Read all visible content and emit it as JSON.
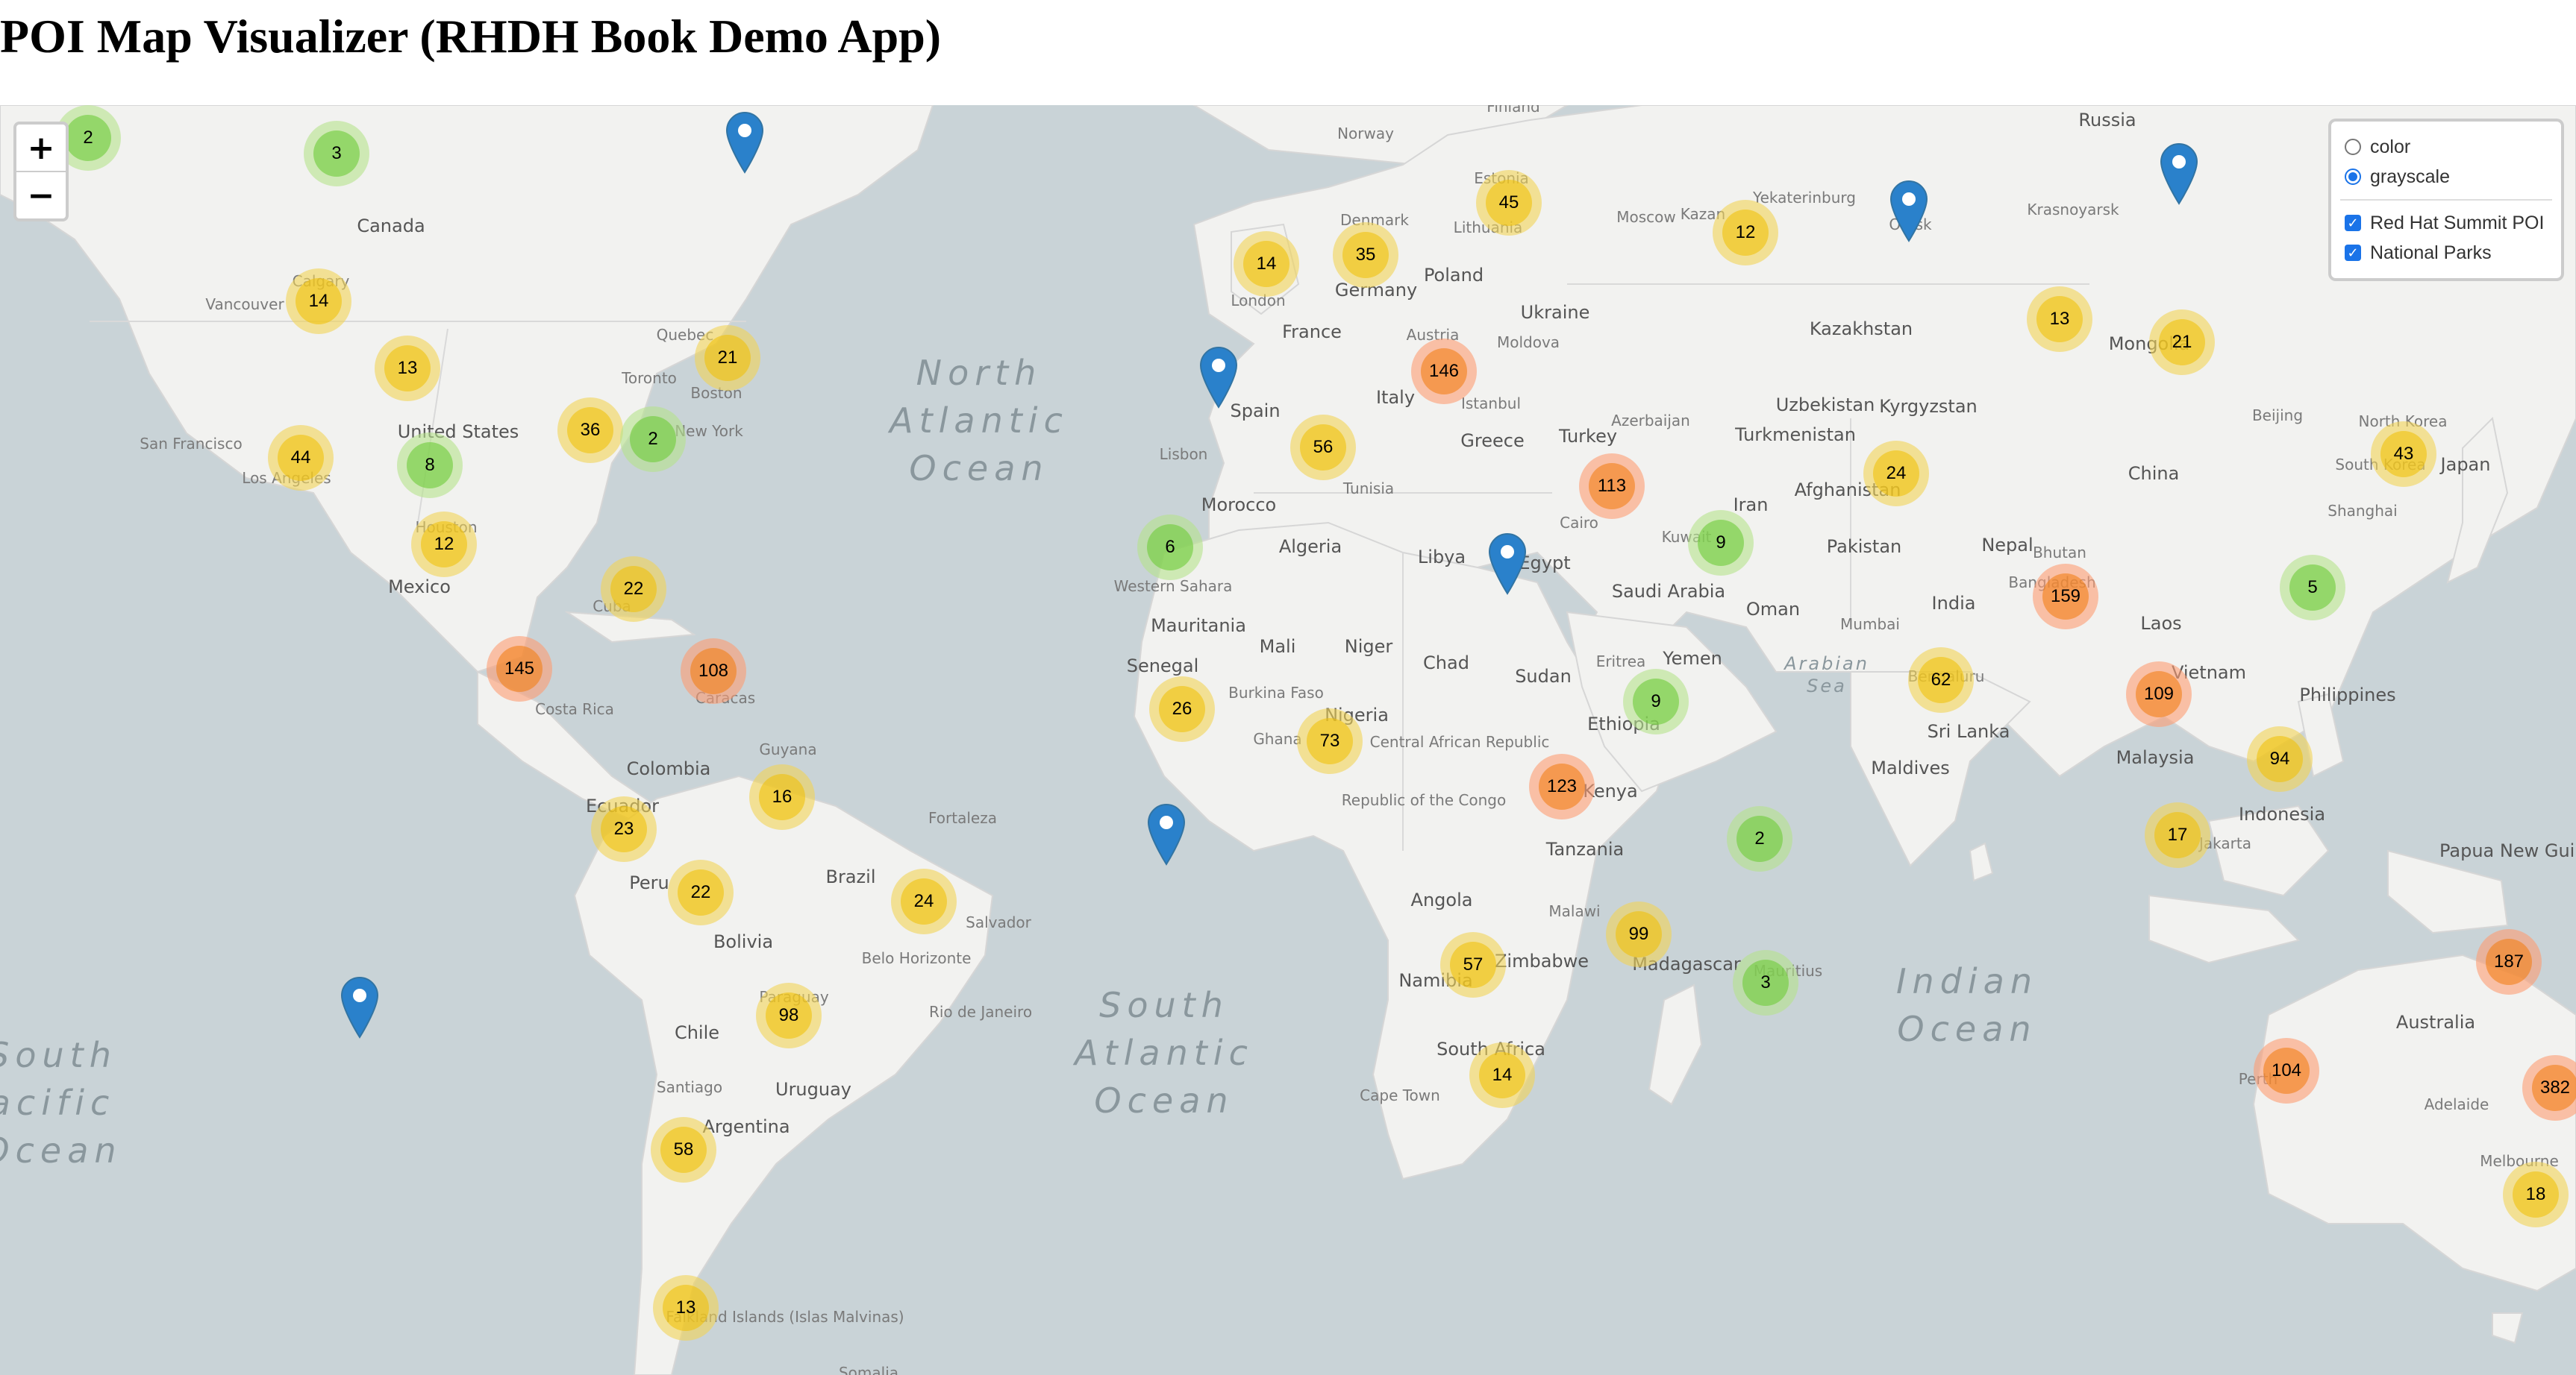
{
  "page": {
    "title": "POI Map Visualizer (RHDH Book Demo App)"
  },
  "map_controls": {
    "zoom_in_label": "+",
    "zoom_out_label": "−"
  },
  "layer_control": {
    "base_layers": [
      {
        "label": "color",
        "selected": false
      },
      {
        "label": "grayscale",
        "selected": true
      }
    ],
    "overlays": [
      {
        "label": "Red Hat Summit POI",
        "checked": true
      },
      {
        "label": "National Parks",
        "checked": true
      }
    ]
  },
  "cluster_colors": {
    "small": "#6ecc39",
    "medium": "#f0c20c",
    "large": "#f18017"
  },
  "marker_color": "#2a81cb",
  "labels": {
    "oceans": [
      "North\nAtlantic\nOcean",
      "South\nAtlantic\nOcean",
      "Indian\nOcean",
      "South\nacific\nOcean"
    ],
    "seas": [
      "Arabian\nSea"
    ],
    "countries": [
      "Canada",
      "United States",
      "Mexico",
      "Colombia",
      "Ecuador",
      "Peru",
      "Brazil",
      "Bolivia",
      "Chile",
      "Argentina",
      "Uruguay",
      "Guyana",
      "Paraguay",
      "Costa Rica",
      "Cuba",
      "Russia",
      "Kazakhstan",
      "Ukraine",
      "Poland",
      "Germany",
      "France",
      "Spain",
      "Italy",
      "Greece",
      "Turkey",
      "Iran",
      "Saudi Arabia",
      "Egypt",
      "Libya",
      "Algeria",
      "Morocco",
      "Tunisia",
      "Mali",
      "Niger",
      "Chad",
      "Sudan",
      "Mauritania",
      "Senegal",
      "Burkina Faso",
      "Ghana",
      "Nigeria",
      "Central African Republic",
      "Republic of the Congo",
      "Angola",
      "Namibia",
      "Zimbabwe",
      "South Africa",
      "Tanzania",
      "Kenya",
      "Ethiopia",
      "Eritrea",
      "Yemen",
      "Oman",
      "Pakistan",
      "Afghanistan",
      "Uzbekistan",
      "Kyrgyzstan",
      "Turkmenistan",
      "India",
      "Nepal",
      "Bhutan",
      "Bangladesh",
      "China",
      "Mongolia",
      "Japan",
      "North Korea",
      "South Korea",
      "Laos",
      "Vietnam",
      "Malaysia",
      "Indonesia",
      "Philippines",
      "Papua New Guinea",
      "Australia",
      "Sri Lanka",
      "Maldives",
      "Madagascar",
      "Malawi",
      "Norway",
      "Finland",
      "Denmark",
      "Estonia",
      "Lithuania",
      "Austria",
      "Moldova",
      "Azerbaijan",
      "Kuwait",
      "Western Sahara",
      "Falkland Islands (Islas Malvinas)",
      "Somalia"
    ],
    "cities": [
      "Vancouver",
      "San Francisco",
      "Los Angeles",
      "Houston",
      "Toronto",
      "Quebec",
      "Boston",
      "New York",
      "Caracas",
      "Fortaleza",
      "Salvador",
      "Belo Horizonte",
      "Rio de Janeiro",
      "Santiago",
      "Moscow",
      "Kazan",
      "Yekaterinburg",
      "Omsk",
      "Krasnoyarsk",
      "London",
      "Lisbon",
      "Istanbul",
      "Cairo",
      "Beijing",
      "Shanghai",
      "Mumbai",
      "Bengaluru",
      "Jakarta",
      "Perth",
      "Adelaide",
      "Melbourne",
      "Cape Town",
      "Calgary",
      "Mauritius"
    ]
  },
  "clusters": [
    {
      "count": "2",
      "size": "small"
    },
    {
      "count": "3",
      "size": "small"
    },
    {
      "count": "14",
      "size": "medium"
    },
    {
      "count": "13",
      "size": "medium"
    },
    {
      "count": "44",
      "size": "medium"
    },
    {
      "count": "8",
      "size": "small"
    },
    {
      "count": "36",
      "size": "medium"
    },
    {
      "count": "2",
      "size": "small"
    },
    {
      "count": "21",
      "size": "medium"
    },
    {
      "count": "12",
      "size": "medium"
    },
    {
      "count": "22",
      "size": "medium"
    },
    {
      "count": "145",
      "size": "large"
    },
    {
      "count": "108",
      "size": "large"
    },
    {
      "count": "16",
      "size": "medium"
    },
    {
      "count": "23",
      "size": "medium"
    },
    {
      "count": "22",
      "size": "medium"
    },
    {
      "count": "24",
      "size": "medium"
    },
    {
      "count": "98",
      "size": "medium"
    },
    {
      "count": "58",
      "size": "medium"
    },
    {
      "count": "13",
      "size": "medium"
    },
    {
      "count": "14",
      "size": "medium"
    },
    {
      "count": "35",
      "size": "medium"
    },
    {
      "count": "45",
      "size": "medium"
    },
    {
      "count": "146",
      "size": "large"
    },
    {
      "count": "56",
      "size": "medium"
    },
    {
      "count": "6",
      "size": "small"
    },
    {
      "count": "26",
      "size": "medium"
    },
    {
      "count": "73",
      "size": "medium"
    },
    {
      "count": "113",
      "size": "large"
    },
    {
      "count": "9",
      "size": "small"
    },
    {
      "count": "9",
      "size": "small"
    },
    {
      "count": "123",
      "size": "large"
    },
    {
      "count": "2",
      "size": "small"
    },
    {
      "count": "99",
      "size": "medium"
    },
    {
      "count": "3",
      "size": "small"
    },
    {
      "count": "57",
      "size": "medium"
    },
    {
      "count": "14",
      "size": "medium"
    },
    {
      "count": "12",
      "size": "medium"
    },
    {
      "count": "13",
      "size": "medium"
    },
    {
      "count": "21",
      "size": "medium"
    },
    {
      "count": "24",
      "size": "medium"
    },
    {
      "count": "62",
      "size": "medium"
    },
    {
      "count": "159",
      "size": "large"
    },
    {
      "count": "43",
      "size": "medium"
    },
    {
      "count": "5",
      "size": "small"
    },
    {
      "count": "109",
      "size": "large"
    },
    {
      "count": "94",
      "size": "medium"
    },
    {
      "count": "17",
      "size": "medium"
    },
    {
      "count": "187",
      "size": "large"
    },
    {
      "count": "104",
      "size": "large"
    },
    {
      "count": "382",
      "size": "large"
    },
    {
      "count": "18",
      "size": "medium"
    }
  ]
}
